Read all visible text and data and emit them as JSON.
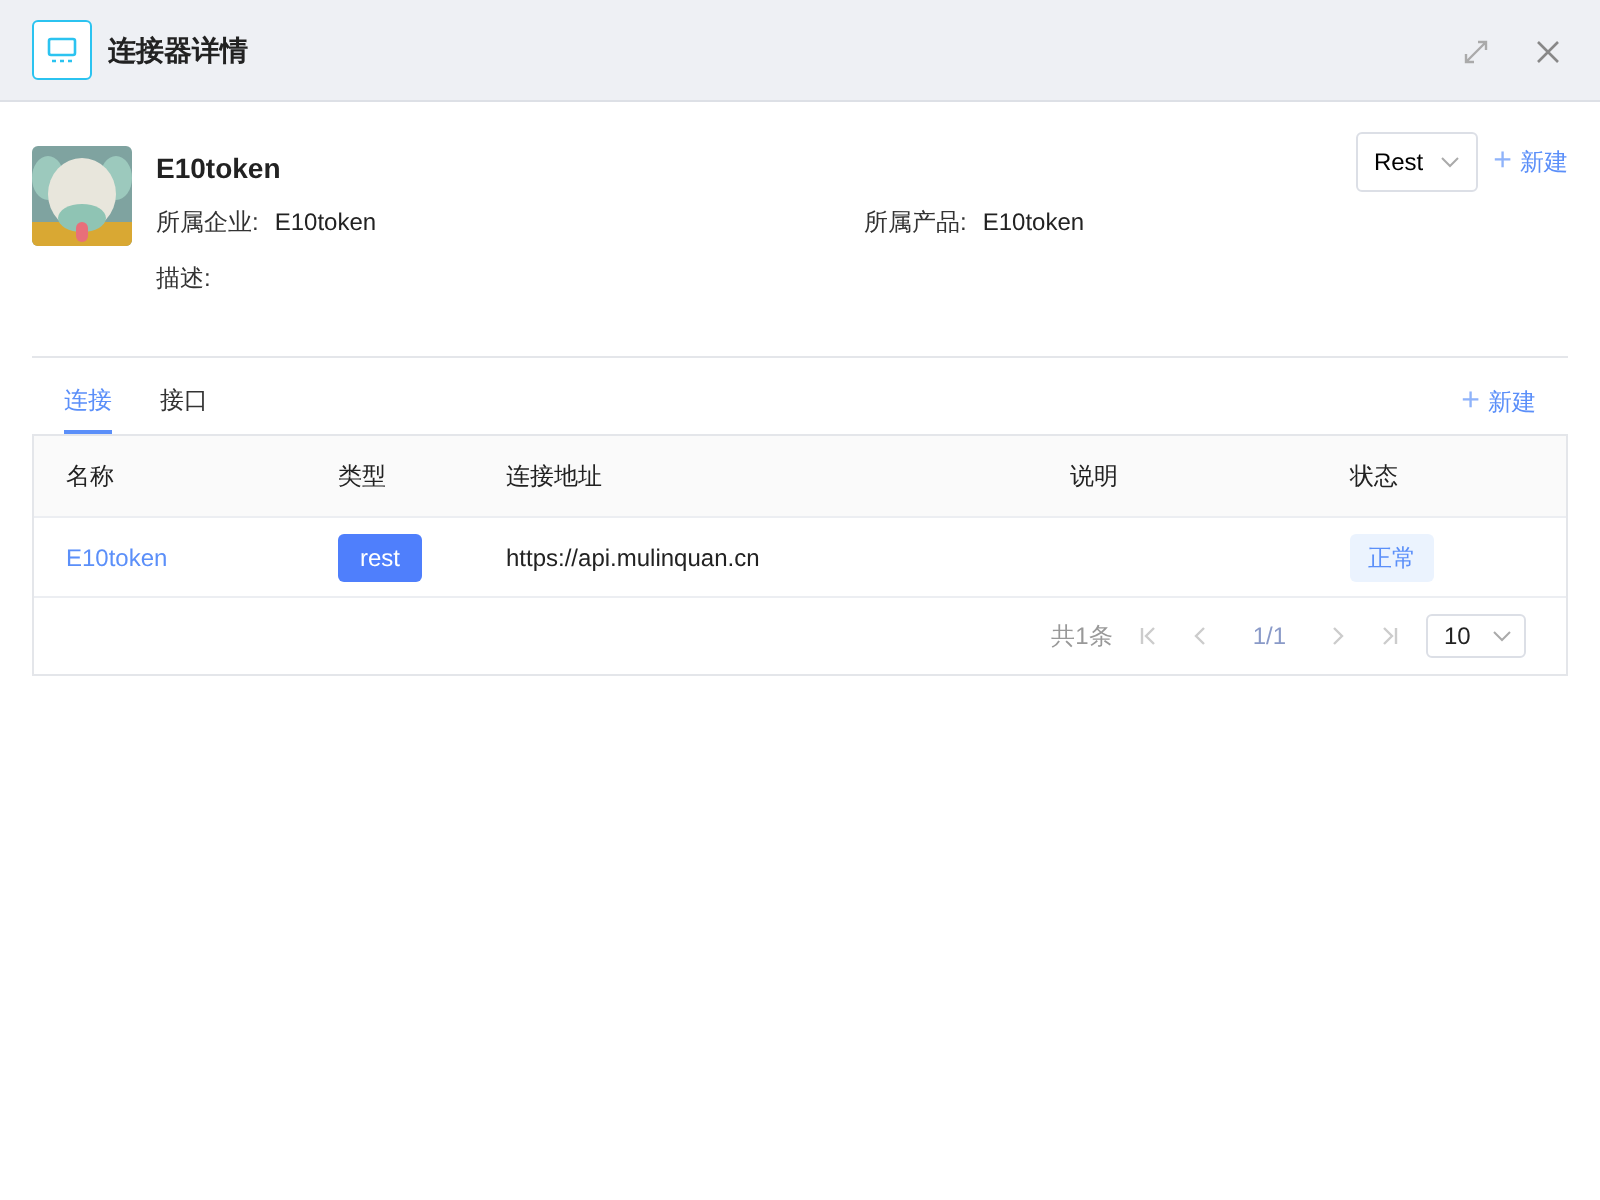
{
  "window": {
    "title": "连接器详情"
  },
  "connector": {
    "name": "E10token",
    "fields": [
      {
        "label": "所属企业:",
        "value": "E10token"
      },
      {
        "label": "所属产品:",
        "value": "E10token"
      },
      {
        "label": "描述:"
      }
    ],
    "type_select": {
      "value": "Rest"
    },
    "new_button": {
      "label": "新建",
      "icon": "+"
    }
  },
  "tabs": [
    {
      "label": "连接",
      "selected": true
    },
    {
      "label": "接口",
      "selected": false
    }
  ],
  "tab_action": {
    "label": "新建",
    "icon": "+"
  },
  "table": {
    "columns": [
      "名称",
      "类型",
      "连接地址",
      "说明",
      "状态"
    ],
    "rows": [
      {
        "name": "E10token",
        "type": "rest",
        "address": "https://api.mulinquan.cn",
        "status": "正常"
      }
    ]
  },
  "pagination": {
    "total": "共1条",
    "page": "1/1",
    "page_size": "10"
  }
}
